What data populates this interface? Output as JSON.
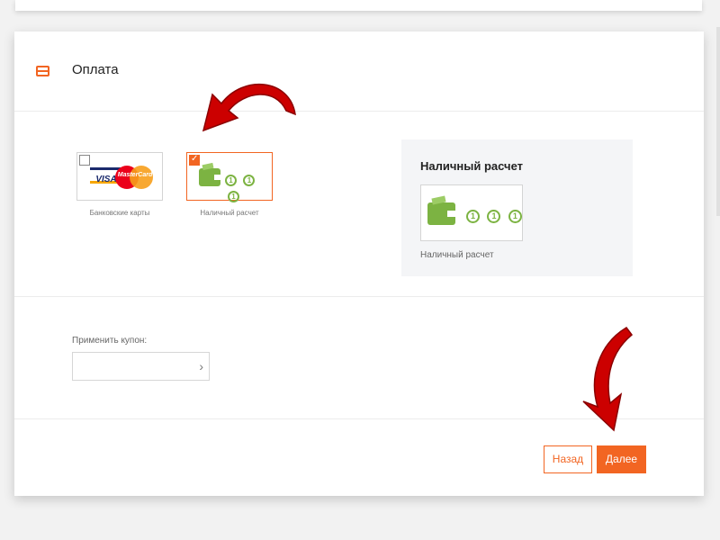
{
  "header": {
    "title": "Оплата",
    "icon": "card-icon"
  },
  "payment_methods": [
    {
      "label": "Банковские карты",
      "icon": "bank-cards-icon",
      "selected": false,
      "card_brands": [
        "VISA",
        "MasterCard"
      ]
    },
    {
      "label": "Наличный расчет",
      "icon": "cash-wallet-icon",
      "selected": true
    }
  ],
  "coin_glyph": "1",
  "selected_panel": {
    "title": "Наличный расчет",
    "label": "Наличный расчет"
  },
  "coupon": {
    "label": "Применить купон:",
    "value": "",
    "placeholder": ""
  },
  "buttons": {
    "back": "Назад",
    "next": "Далее"
  },
  "colors": {
    "accent": "#f26522",
    "wallet_green": "#7cb342",
    "arrow_red": "#cc0000"
  }
}
